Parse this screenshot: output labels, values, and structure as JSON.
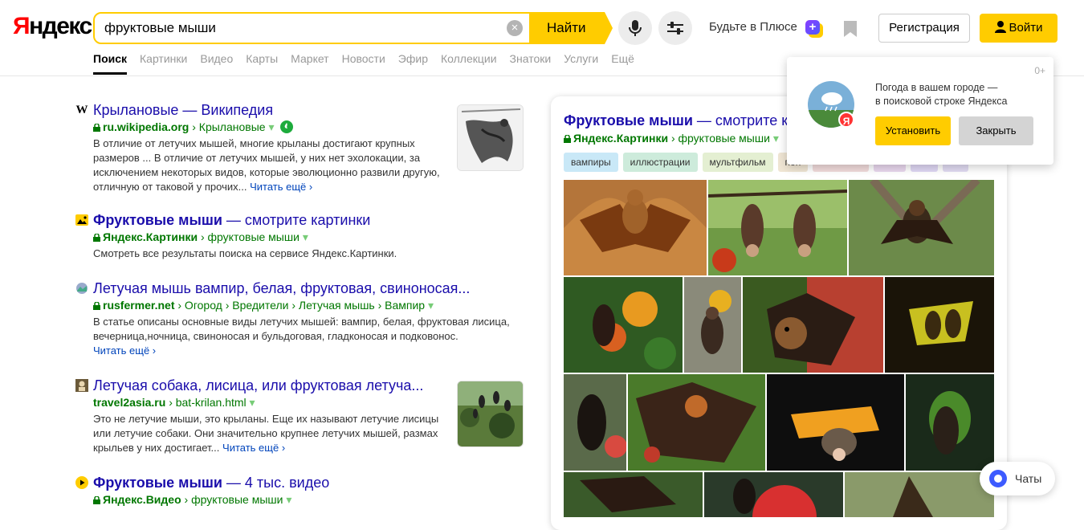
{
  "logo": {
    "first": "Я",
    "rest": "ндекс"
  },
  "search": {
    "value": "фруктовые мыши",
    "find_label": "Найти"
  },
  "plus": {
    "text": "Будьте в Плюсе",
    "badge": "+"
  },
  "auth": {
    "register": "Регистрация",
    "login": "Войти"
  },
  "nav": [
    "Поиск",
    "Картинки",
    "Видео",
    "Карты",
    "Маркет",
    "Новости",
    "Эфир",
    "Коллекции",
    "Знатоки",
    "Услуги",
    "Ещё"
  ],
  "results": [
    {
      "icon": "W",
      "title": "Крылановые — Википедия",
      "domain": "ru.wikipedia.org",
      "path": "› Крылановые",
      "snippet": "В отличие от летучих мышей, многие крыланы достигают крупных размеров ... В отличие от летучих мышей, у них нет эхолокации, за исключением некоторых видов, которые эволюционно развили другую, отличную от таковой у прочих...",
      "more": "Читать ещё ›"
    },
    {
      "title_bold": "Фруктовые мыши",
      "title_rest": " — смотрите картинки",
      "domain": "Яндекс.Картинки",
      "path": "› фруктовые мыши",
      "snippet": "Смотреть все результаты поиска на сервисе Яндекс.Картинки."
    },
    {
      "title": "Летучая мышь вампир, белая, фруктовая, свиноносая...",
      "domain": "rusfermer.net",
      "path": "› Огород › Вредители › Летучая мышь › Вампир",
      "snippet": "В статье описаны основные виды летучих мышей: вампир, белая, фруктовая лисица, вечерница,ночница, свиноносая и бульдоговая, гладконосая и подковонос.",
      "more": "Читать ещё ›"
    },
    {
      "title": "Летучая собака, лисица, или фруктовая летуча...",
      "domain": "travel2asia.ru",
      "path": "› bat-krilan.html",
      "snippet": "Это не летучие мыши, это крыланы. Еще их называют летучие лисицы или летучие собаки. Они значительно крупнее летучих мышей, размах крыльев у них достигает...",
      "more": "Читать ещё ›"
    },
    {
      "title_bold": "Фруктовые мыши",
      "title_rest": " — 4 тыс. видео",
      "domain": "Яндекс.Видео",
      "path": "› фруктовые мыши"
    }
  ],
  "images_panel": {
    "title_bold": "Фруктовые мыши",
    "title_rest": " — смотрите к",
    "domain": "Яндекс.Картинки",
    "path": "› фруктовые мыши",
    "tags": [
      "вампиры",
      "иллюстрации",
      "мультфильм",
      "пон"
    ]
  },
  "popup": {
    "age": "0+",
    "text_line1": "Погода в вашем городе —",
    "text_line2": "в поисковой строке Яндекса",
    "badge": "Я",
    "install": "Установить",
    "close": "Закрыть"
  },
  "chats": "Чаты",
  "colors": {
    "yellow": "#ffcc00",
    "link": "#1a0dab",
    "green": "#007700",
    "red": "#ff0000"
  }
}
